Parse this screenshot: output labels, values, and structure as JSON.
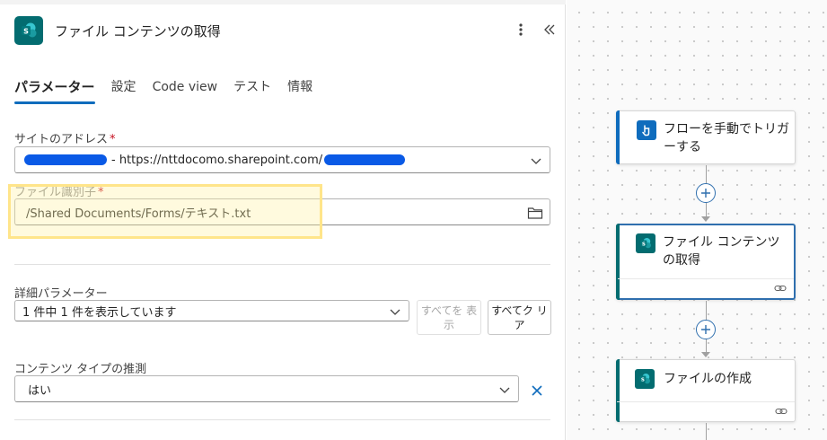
{
  "panel": {
    "title": "ファイル コンテンツの取得",
    "tabs": [
      {
        "label": "パラメーター",
        "active": true
      },
      {
        "label": "設定",
        "active": false
      },
      {
        "label": "Code view",
        "active": false
      },
      {
        "label": "テスト",
        "active": false
      },
      {
        "label": "情報",
        "active": false
      }
    ]
  },
  "site_address": {
    "label": "サイトのアドレス",
    "required": "*",
    "value_suffix": "- https://nttdocomo.sharepoint.com/"
  },
  "file_id": {
    "label": "ファイル識別子",
    "required": "*",
    "value": "/Shared Documents/Forms/テキスト.txt"
  },
  "advanced": {
    "label": "詳細パラメーター",
    "dropdown_value": "1 件中 1 件を表示しています",
    "show_all_label": "すべてを 表示",
    "clear_all_label": "すべてク リア"
  },
  "content_type": {
    "label": "コンテンツ タイプの推測",
    "value": "はい"
  },
  "flow": {
    "cards": [
      {
        "title": "フローを手動でトリガーする",
        "icon": "manual-trigger-icon",
        "accent": "#0f6cbd"
      },
      {
        "title": "ファイル コンテンツの取得",
        "icon": "sharepoint-icon",
        "accent": "#036c70",
        "selected": true
      },
      {
        "title": "ファイルの作成",
        "icon": "sharepoint-icon",
        "accent": "#036c70"
      }
    ]
  },
  "colors": {
    "sharepoint": "#036c70",
    "accent_blue": "#0f6cbd",
    "highlight": "#ffe58a",
    "required": "#c50f1f"
  }
}
